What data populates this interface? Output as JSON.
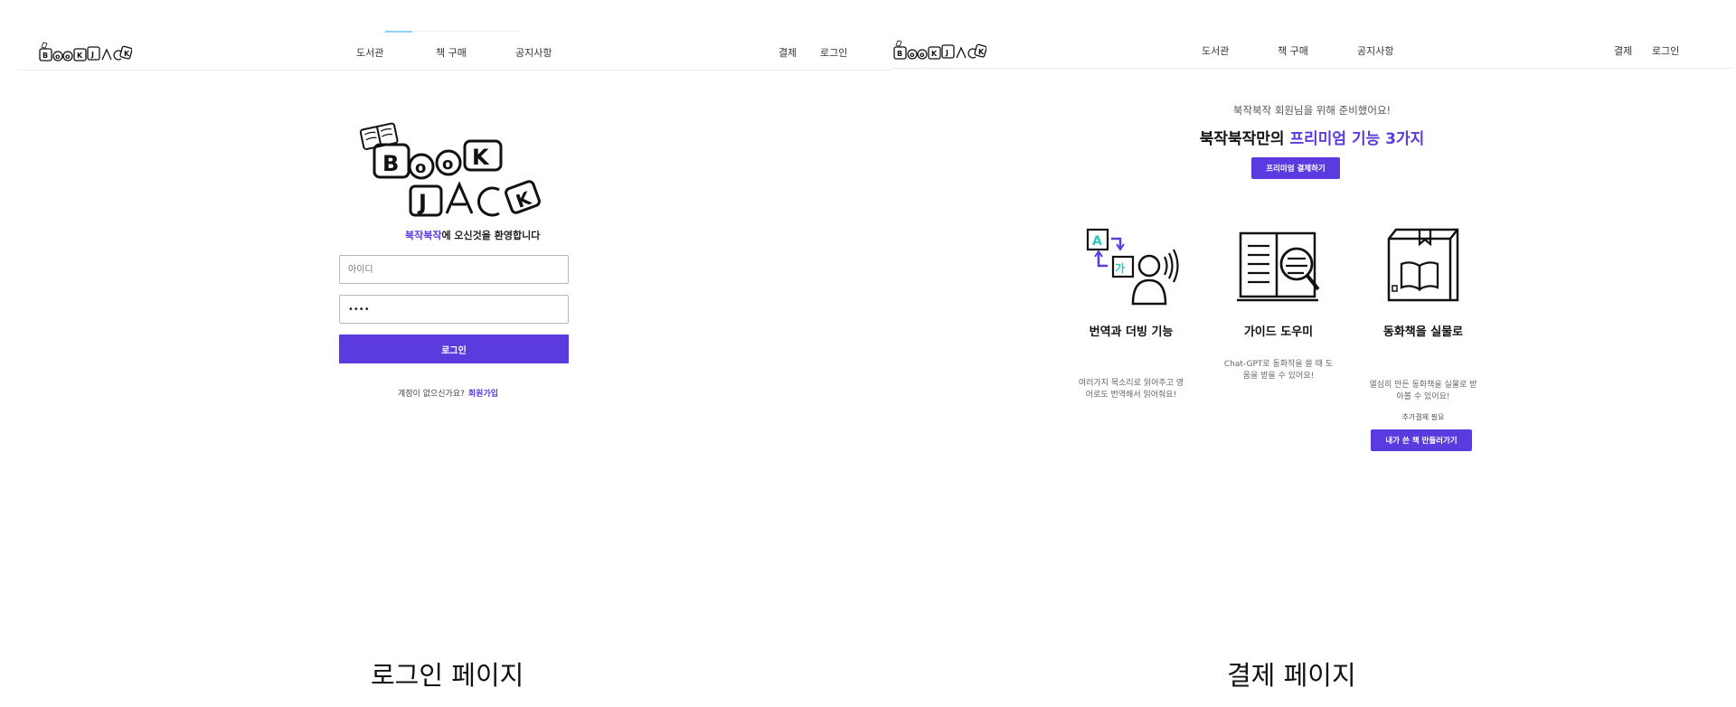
{
  "login_page": {
    "nav": {
      "logo_text": "BOOKJACK",
      "menu": [
        "도서관",
        "책 구매",
        "공지사항"
      ],
      "right": [
        "결제",
        "로그인"
      ]
    },
    "big_logo_text": "BOOKJACK",
    "welcome_brand": "북작북작",
    "welcome_rest": "에 오신것을 환영합니다",
    "id_placeholder": "아이디",
    "password_value": "1234",
    "login_button": "로그인",
    "signup_prompt": "계정이 없으신가요?",
    "signup_link": "회원가입",
    "caption": "로그인 페이지"
  },
  "payment_page": {
    "nav": {
      "logo_text": "BOOKJACK",
      "menu": [
        "도서관",
        "책 구매",
        "공지사항"
      ],
      "right": [
        "결제",
        "로그인"
      ]
    },
    "subtitle": "북작북작 회원님을 위해 준비했어요!",
    "title_prefix": "북작북작만의 ",
    "title_highlight": "프리미엄 기능 3가지",
    "premium_button": "프리미엄 결제하기",
    "features": [
      {
        "icon": "translate-voice-icon",
        "title": "번역과 더빙 기능",
        "desc": "여러가지 목소리로 읽어주고 영어로도 번역해서 읽어줘요!"
      },
      {
        "icon": "book-magnifier-icon",
        "title": "가이드 도우미",
        "desc": "Chat-GPT로 동화작을 쓸 때 도움을 받을 수 있어요!"
      },
      {
        "icon": "book-box-icon",
        "title": "동화책을 실물로",
        "desc": "열심히 만든 동화책을 실물로 받아볼 수 있어요!",
        "note": "추가결제 필요",
        "button": "내가 쓴 책 만들러가기"
      }
    ],
    "caption": "결제 페이지"
  },
  "colors": {
    "accent": "#5b3be0",
    "teal": "#2fc7b8",
    "nav_active": "#8fd3f4"
  }
}
